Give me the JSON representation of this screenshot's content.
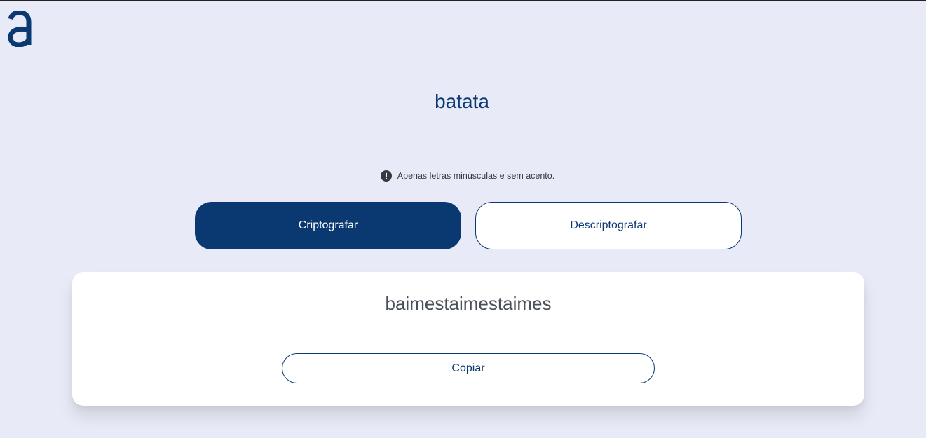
{
  "logo": {
    "icon": "alura-a-logo",
    "color": "#0A3871"
  },
  "input": {
    "value": "batata"
  },
  "hint": {
    "icon": "exclamation-circle-icon",
    "text": "Apenas letras minúsculas e sem acento."
  },
  "buttons": {
    "encrypt_label": "Criptografar",
    "decrypt_label": "Descriptografar"
  },
  "output": {
    "text": "baimestaimestaimes",
    "copy_label": "Copiar"
  },
  "colors": {
    "background": "#E8EBF7",
    "primary": "#0A3871",
    "card": "#FFFFFF",
    "output_text": "#495057"
  }
}
